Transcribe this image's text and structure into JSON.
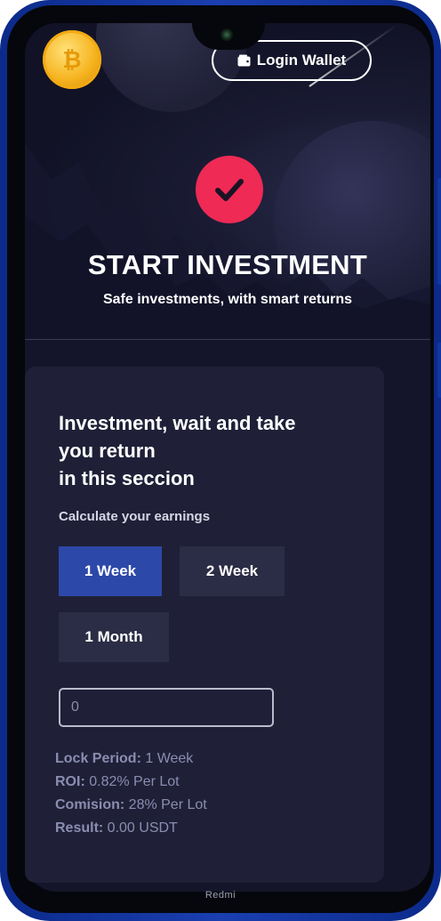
{
  "header": {
    "logo_icon": "coin-logo-icon",
    "login_button": {
      "label": "Login Wallet",
      "icon": "wallet-icon"
    }
  },
  "hero": {
    "icon": "checkmark-circle-icon",
    "title": "START INVESTMENT",
    "subtitle": "Safe investments, with smart returns"
  },
  "card": {
    "title_line1": "Investment, wait and take",
    "title_line2": "you return",
    "title_line3": "in this seccion",
    "calc_label": "Calculate your earnings",
    "periods": [
      {
        "label": "1 Week",
        "active": true
      },
      {
        "label": "2 Week",
        "active": false
      },
      {
        "label": "1 Month",
        "active": false
      }
    ],
    "amount_input": {
      "value": "",
      "placeholder": "0"
    },
    "info": [
      {
        "key": "Lock Period:",
        "value": " 1 Week"
      },
      {
        "key": "ROI:",
        "value": " 0.82% Per Lot"
      },
      {
        "key": "Comision:",
        "value": " 28% Per Lot"
      },
      {
        "key": "Result:",
        "value": " 0.00 USDT"
      }
    ]
  },
  "device": {
    "brand": "Redmi"
  },
  "colors": {
    "accent_red": "#ee2a55",
    "active_blue": "#2c48a8",
    "card_bg": "#1f2037",
    "page_bg": "#14152a",
    "info_text": "#8a8db0"
  }
}
